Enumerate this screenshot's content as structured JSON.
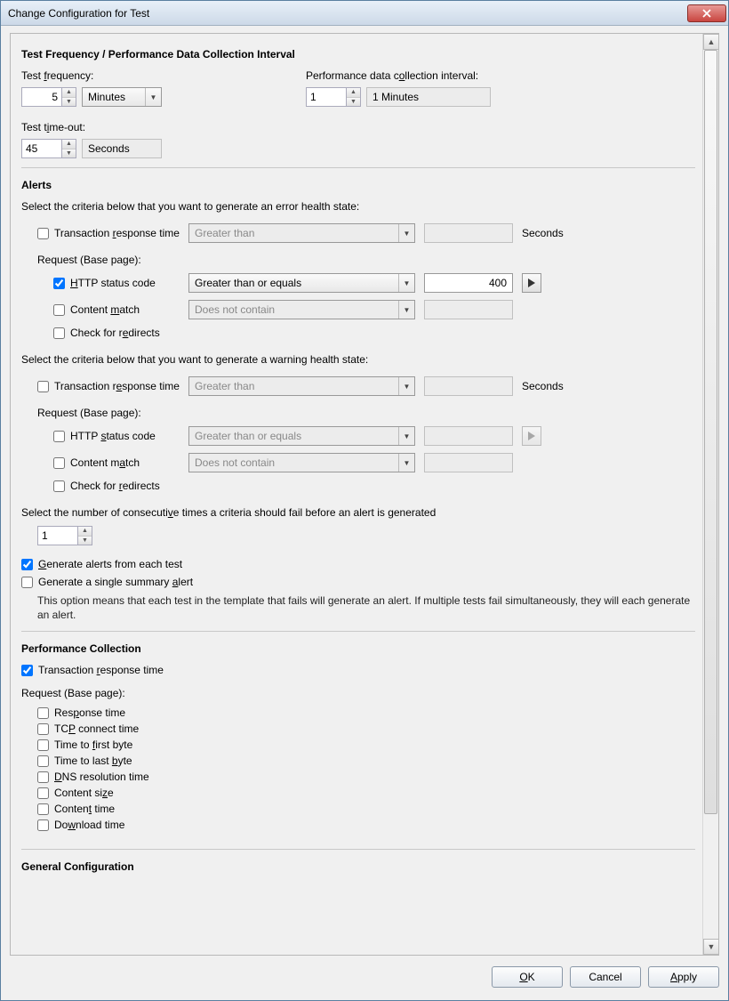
{
  "window": {
    "title": "Change Configuration for Test"
  },
  "freq": {
    "heading": "Test Frequency / Performance Data Collection Interval",
    "test_freq_label": "Test frequency:",
    "test_freq_value": "5",
    "test_freq_unit": "Minutes",
    "perf_label": "Performance data collection interval:",
    "perf_value": "1",
    "perf_display": "1 Minutes",
    "timeout_label": "Test time-out:",
    "timeout_value": "45",
    "timeout_unit": "Seconds"
  },
  "alerts": {
    "heading": "Alerts",
    "error_intro": "Select the criteria below that you want to generate an error health state:",
    "warn_intro": "Select the criteria below that you want to generate a warning health state:",
    "trt_label": "Transaction response time",
    "trt_op": "Greater than",
    "trt_unit": "Seconds",
    "request_label": "Request (Base page):",
    "http_label": "HTTP status code",
    "http_op": "Greater than or equals",
    "http_val": "400",
    "content_label": "Content match",
    "content_op": "Does not contain",
    "redirect_label": "Check for redirects",
    "consecutive_label": "Select the number of consecutive times a criteria should fail before an alert is generated",
    "consecutive_value": "1",
    "gen_each_label": "Generate alerts from each test",
    "gen_single_label": "Generate a single summary alert",
    "gen_desc": "This option means that each test in the template that fails will generate an alert. If multiple tests fail simultaneously, they will each generate an alert."
  },
  "perf": {
    "heading": "Performance Collection",
    "trt_label": "Transaction response time",
    "request_label": "Request (Base page):",
    "items": {
      "response": "Response time",
      "tcp": "TCP connect time",
      "firstbyte": "Time to first byte",
      "lastbyte": "Time to last byte",
      "dns": "DNS resolution time",
      "size": "Content size",
      "ctime": "Content time",
      "download": "Download time"
    }
  },
  "general": {
    "heading": "General Configuration"
  },
  "buttons": {
    "ok": "OK",
    "cancel": "Cancel",
    "apply": "Apply"
  }
}
